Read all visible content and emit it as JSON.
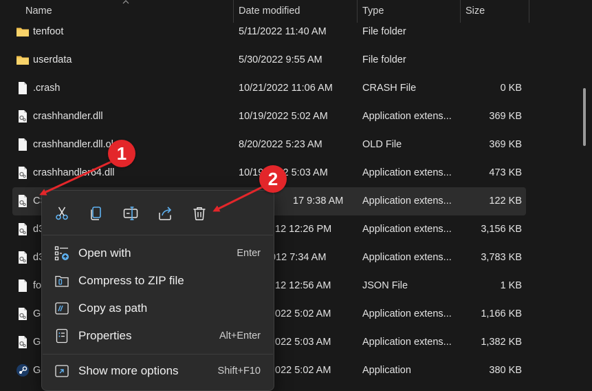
{
  "columns": {
    "name": "Name",
    "date": "Date modified",
    "type": "Type",
    "size": "Size"
  },
  "rows": [
    {
      "name": "tenfoot",
      "date": "5/11/2022 11:40 AM",
      "type": "File folder",
      "size": "",
      "icon": "folder-icon"
    },
    {
      "name": "userdata",
      "date": "5/30/2022 9:55 AM",
      "type": "File folder",
      "size": "",
      "icon": "folder-icon"
    },
    {
      "name": ".crash",
      "date": "10/21/2022 11:06 AM",
      "type": "CRASH File",
      "size": "0 KB",
      "icon": "file-icon"
    },
    {
      "name": "crashhandler.dll",
      "date": "10/19/2022 5:02 AM",
      "type": "Application extens...",
      "size": "369 KB",
      "icon": "dll-icon"
    },
    {
      "name": "crashhandler.dll.ol",
      "date": "8/20/2022 5:23 AM",
      "type": "OLD File",
      "size": "369 KB",
      "icon": "file-icon"
    },
    {
      "name": "crashhandler64.dll",
      "date": "10/19/2022 5:03 AM",
      "type": "Application extens...",
      "size": "473 KB",
      "icon": "dll-icon"
    },
    {
      "name": "CS",
      "date": "17 9:38 AM",
      "type": "Application extens...",
      "size": "122 KB",
      "icon": "dll-icon"
    },
    {
      "name": "d3",
      "date": "12 12:26 PM",
      "type": "Application extens...",
      "size": "3,156 KB",
      "icon": "dll-icon"
    },
    {
      "name": "d3",
      "date": "012 7:34 AM",
      "type": "Application extens...",
      "size": "3,783 KB",
      "icon": "dll-icon"
    },
    {
      "name": "fo",
      "date": "12 12:56 AM",
      "type": "JSON File",
      "size": "1 KB",
      "icon": "file-icon"
    },
    {
      "name": "Ga",
      "date": "022 5:02 AM",
      "type": "Application extens...",
      "size": "1,166 KB",
      "icon": "dll-icon"
    },
    {
      "name": "Ga",
      "date": "022 5:03 AM",
      "type": "Application extens...",
      "size": "1,382 KB",
      "icon": "dll-icon"
    },
    {
      "name": "Ga",
      "date": "022 5:02 AM",
      "type": "Application",
      "size": "380 KB",
      "icon": "steam-icon"
    }
  ],
  "context_menu": {
    "quick_actions": [
      "cut-icon",
      "copy-icon",
      "rename-icon",
      "share-icon",
      "delete-icon"
    ],
    "items": [
      {
        "label": "Open with",
        "shortcut": "Enter",
        "icon": "open-with-icon"
      },
      {
        "label": "Compress to ZIP file",
        "shortcut": "",
        "icon": "zip-icon"
      },
      {
        "label": "Copy as path",
        "shortcut": "",
        "icon": "copy-path-icon"
      },
      {
        "label": "Properties",
        "shortcut": "Alt+Enter",
        "icon": "properties-icon"
      }
    ],
    "more": {
      "label": "Show more options",
      "shortcut": "Shift+F10",
      "icon": "show-more-icon"
    }
  },
  "annotations": {
    "badge1": "1",
    "badge2": "2",
    "color": "#e3262a"
  },
  "colors": {
    "background": "#191919",
    "menu": "#2b2b2b",
    "accent_icon": "#5fb2f2",
    "folder": "#f2c14e"
  }
}
